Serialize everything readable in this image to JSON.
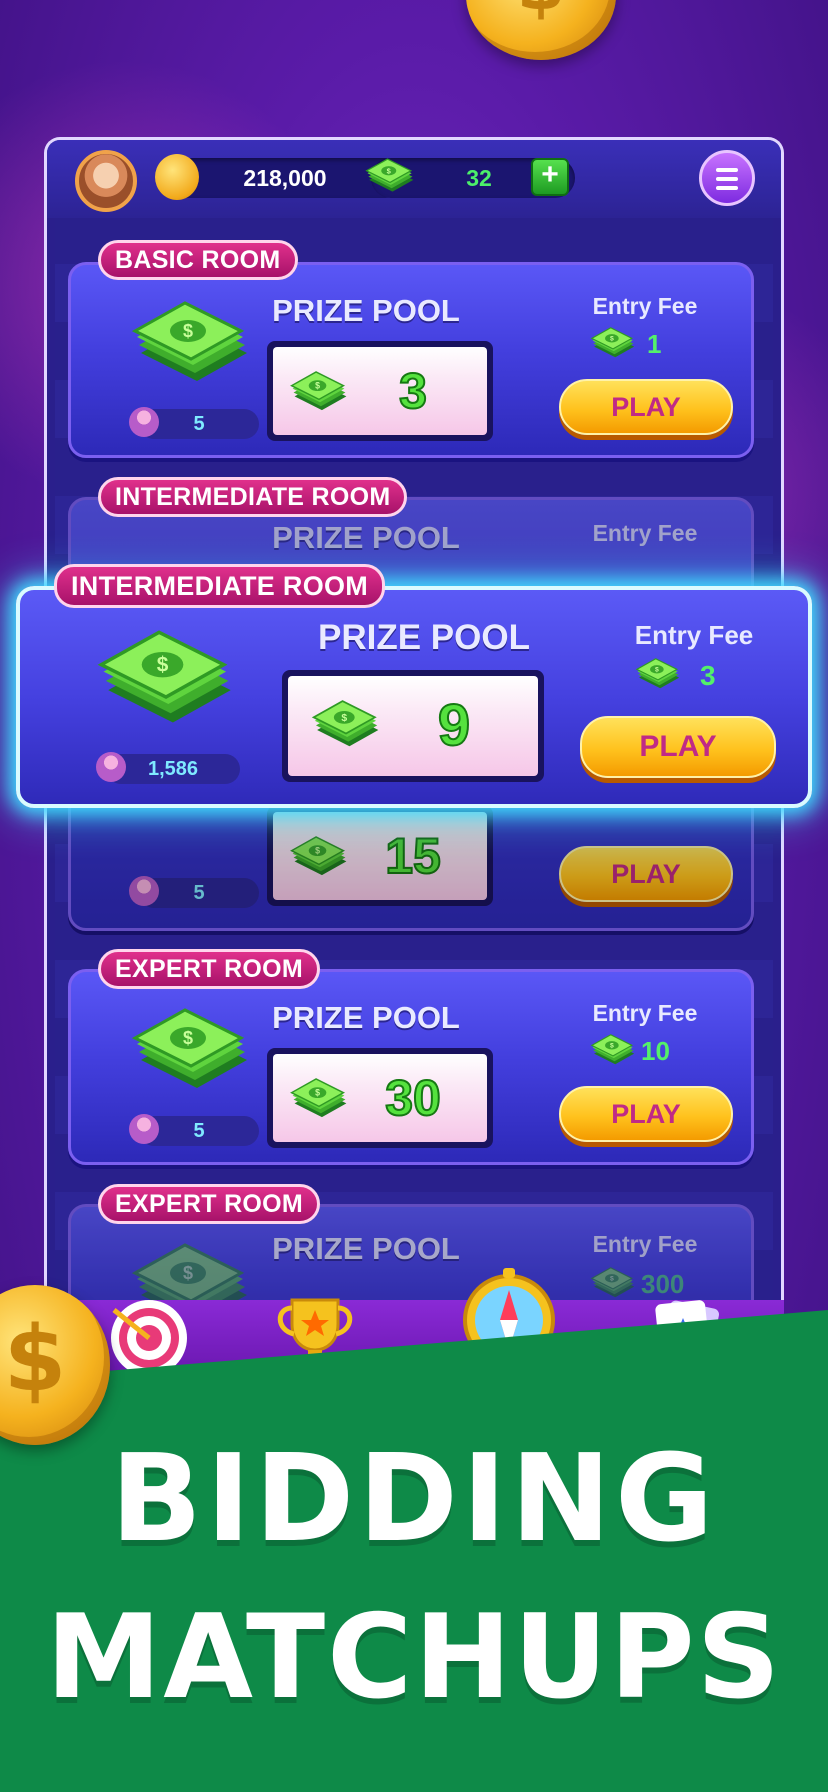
{
  "header": {
    "coins": "218,000",
    "cash": "32",
    "plus_label": "+"
  },
  "rooms": [
    {
      "tag": "BASIC ROOM",
      "prize_label": "PRIZE POOL",
      "prize": "3",
      "entry_label": "Entry Fee",
      "entry_fee": "1",
      "players": "5",
      "play_label": "PLAY"
    },
    {
      "tag": "INTERMEDIATE ROOM",
      "prize_label": "PRIZE POOL",
      "prize": "15",
      "entry_label": "Entry Fee",
      "players": "5",
      "play_label": "PLAY"
    },
    {
      "tag": "INTERMEDIATE ROOM",
      "prize_label": "PRIZE POOL",
      "prize": "9",
      "entry_label": "Entry Fee",
      "entry_fee": "3",
      "players": "1,586",
      "play_label": "PLAY"
    },
    {
      "tag": "EXPERT ROOM",
      "prize_label": "PRIZE POOL",
      "prize": "30",
      "entry_label": "Entry Fee",
      "entry_fee": "10",
      "players": "5",
      "play_label": "PLAY"
    },
    {
      "tag": "EXPERT ROOM",
      "prize_label": "PRIZE POOL",
      "entry_label": "Entry Fee",
      "entry_fee": "300"
    }
  ],
  "tabs": [
    {
      "icon": "target-icon"
    },
    {
      "icon": "trophy-icon"
    },
    {
      "icon": "compass-icon"
    },
    {
      "icon": "cards-icon"
    }
  ],
  "headline": {
    "line1": "BIDDING",
    "line2": "MATCHUPS"
  },
  "colors": {
    "background": "#5a1ba8",
    "room": "#433fde",
    "tag": "#e0308c",
    "play": "#ffc21d",
    "cash_green": "#54f06a",
    "footer_green": "#0e8a48",
    "featured_glow": "#40dcff"
  }
}
